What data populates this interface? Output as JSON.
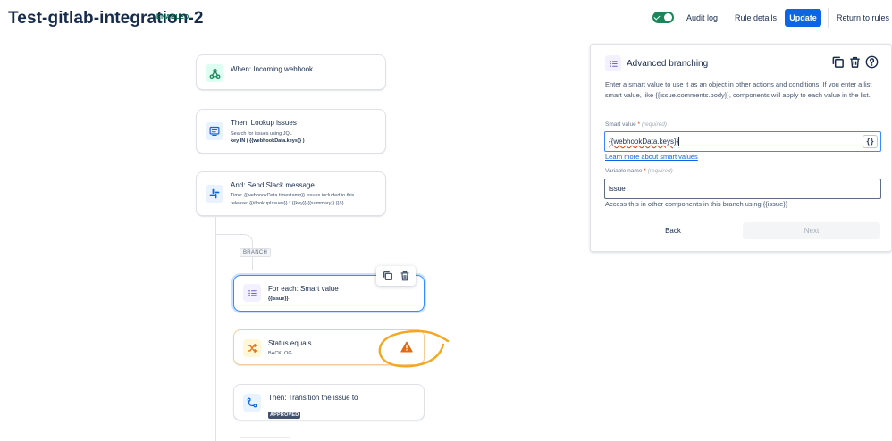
{
  "header": {
    "rule_title": "Test-gitlab-integration-2",
    "status_badge": "ENABLED",
    "audit_log": "Audit log",
    "rule_details": "Rule details",
    "update": "Update",
    "return_to_rules": "Return to rules"
  },
  "canvas": {
    "branch_label": "BRANCH",
    "components": [
      {
        "title": "When: Incoming webhook",
        "icon": "webhook-icon"
      },
      {
        "title": "Then: Lookup issues",
        "line1": "Search for issues using JQL",
        "line2": "key IN ( {{webhookData.keys}} )",
        "icon": "lookup-issues-icon"
      },
      {
        "title": "And: Send Slack message",
        "line1": "Time: {{webhookData.timestamp}} Issues included in this",
        "line2": "release: {{#lookupIssues}} * {{key}} {{summary}} {{/}}",
        "icon": "slack-icon"
      },
      {
        "title": "For each: Smart value",
        "line1": "{{issue}}",
        "icon": "list-icon"
      },
      {
        "title": "Status equals",
        "line1": "BACKLOG",
        "icon": "shuffle-icon"
      },
      {
        "title": "Then: Transition the issue to",
        "lozenge": "APPROVED",
        "icon": "transition-icon"
      }
    ]
  },
  "panel": {
    "title": "Advanced branching",
    "description": "Enter a smart value to use it as an object in other actions and conditions. If you enter a list smart value, like {{issue.comments.body}}, components will apply to each value in the list.",
    "smart_value_label": "Smart value",
    "required_mark": "*",
    "required_text": "(required)",
    "smart_value": "{{webhookData.keys}}",
    "braces_button": "{}",
    "learn_more": "Learn more about smart values",
    "variable_name_label": "Variable name",
    "variable_name": "issue",
    "hint": "Access this in other components in this branch using {{issue}}",
    "back": "Back",
    "next": "Next"
  },
  "colors": {
    "accent": "#0c66e4",
    "enabled_green": "#1f845a",
    "warning": "#e56910",
    "annotation": "#f5a623"
  }
}
